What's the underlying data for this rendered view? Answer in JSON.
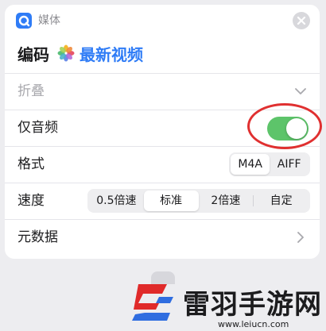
{
  "header": {
    "category_label": "媒体"
  },
  "action": {
    "title": "编码",
    "variable": "最新视频"
  },
  "rows": {
    "collapse": "折叠",
    "audio_only": {
      "label": "仅音频",
      "enabled": true
    },
    "format": {
      "label": "格式",
      "options": [
        "M4A",
        "AIFF"
      ],
      "selected": "M4A"
    },
    "speed": {
      "label": "速度",
      "options": [
        "0.5倍速",
        "标准",
        "2倍速",
        "自定"
      ],
      "selected": "标准"
    },
    "metadata": "元数据"
  },
  "watermark": {
    "brand": "雷羽手游网",
    "url": "www.leiucn.com"
  },
  "colors": {
    "accent": "#2f7cf6",
    "toggle_on": "#5dc46a",
    "annotation": "#e03030"
  },
  "icons": [
    "shortcut-app-icon",
    "close-icon",
    "photos-icon",
    "chevron-down-icon",
    "chevron-right-icon"
  ]
}
